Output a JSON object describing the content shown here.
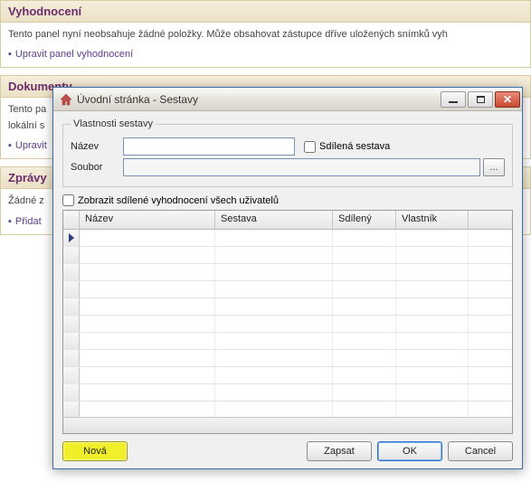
{
  "panels": {
    "eval": {
      "title": "Vyhodnocení",
      "text": "Tento panel nyní neobsahuje žádné položky. Může obsahovat zástupce dříve uložených snímků vyh",
      "link": "Upravit panel vyhodnocení"
    },
    "docs": {
      "title": "Dokumenty",
      "line1": "Tento pa",
      "line2": "lokální s",
      "link": "Upravit"
    },
    "msgs": {
      "title": "Zprávy",
      "text": "Žádné z",
      "link": "Přidat"
    }
  },
  "dialog": {
    "title": "Úvodní stránka - Sestavy",
    "props": {
      "legend": "Vlastnosti sestavy",
      "name_label": "Název",
      "name_value": "",
      "shared_label": "Sdílená sestava",
      "file_label": "Soubor",
      "file_value": "",
      "browse_label": "..."
    },
    "show_shared_label": "Zobrazit sdílené vyhodnocení všech uživatelů",
    "grid": {
      "cols": {
        "c1": "Název",
        "c2": "Sestava",
        "c3": "Sdílený",
        "c4": "Vlastník"
      }
    },
    "buttons": {
      "nova": "Nová",
      "zapsat": "Zapsat",
      "ok": "OK",
      "cancel": "Cancel"
    }
  }
}
